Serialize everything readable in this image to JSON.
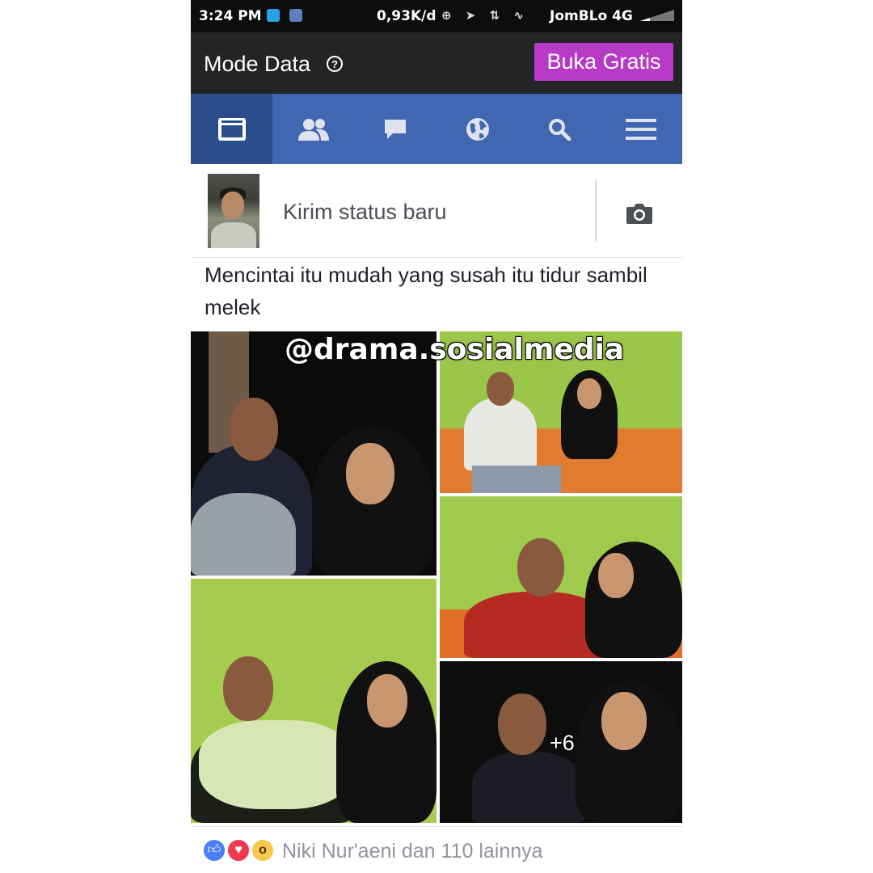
{
  "status_bar": {
    "time": "3:24 PM",
    "speed": "0,93K/d",
    "carrier": "JomBLo 4G",
    "icons": [
      "twitter-icon",
      "bbm-icon",
      "alarm-icon",
      "location-icon",
      "data-arrows-icon",
      "activity-icon",
      "signal-icon"
    ]
  },
  "data_bar": {
    "label": "Mode Data",
    "help_icon": "?",
    "button_label": "Buka Gratis",
    "button_color": "#b83bc7"
  },
  "nav": {
    "color": "#4267b2",
    "active_color": "#2b4d8c",
    "items": [
      {
        "icon": "news-feed-icon",
        "active": true
      },
      {
        "icon": "friends-icon",
        "active": false
      },
      {
        "icon": "messages-icon",
        "active": false
      },
      {
        "icon": "globe-icon",
        "active": false
      },
      {
        "icon": "search-icon",
        "active": false
      },
      {
        "icon": "menu-icon",
        "active": false
      }
    ]
  },
  "composer": {
    "placeholder": "Kirim status baru",
    "camera_icon": "camera-icon"
  },
  "post": {
    "text": "Mencintai itu mudah yang susah itu tidur sambil melek",
    "watermark": "@drama.sosialmedia",
    "more_photos": "+6"
  },
  "reactions": {
    "icons": [
      "like-icon",
      "love-icon",
      "wow-icon"
    ],
    "text": "Niki Nur'aeni dan 110 lainnya"
  }
}
